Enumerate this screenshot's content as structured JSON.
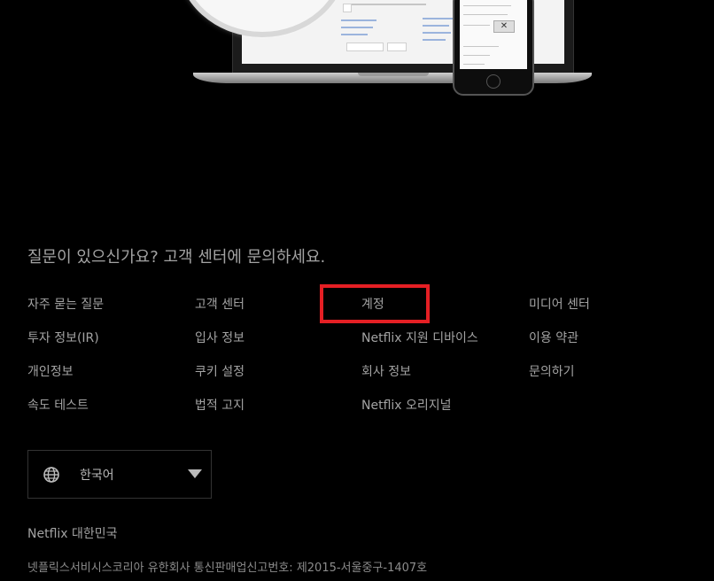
{
  "footer": {
    "questions_text": "질문이 있으신가요? 고객 센터에 문의하세요.",
    "link_columns": [
      [
        "자주 묻는 질문",
        "투자 정보(IR)",
        "개인정보",
        "속도 테스트"
      ],
      [
        "고객 센터",
        "입사 정보",
        "쿠키 설정",
        "법적 고지"
      ],
      [
        "계정",
        "Netflix 지원 디바이스",
        "회사 정보",
        "Netflix 오리지널"
      ],
      [
        "미디어 센터",
        "이용 약관",
        "문의하기"
      ]
    ],
    "highlighted_link": "계정",
    "highlight_color": "#e51f24",
    "language": {
      "selected": "한국어",
      "icon": "globe-icon"
    },
    "country_text": "Netflix 대한민국",
    "legal_text": "넷플릭스서비시스코리아 유한회사 통신판매업신고번호: 제2015-서울중구-1407호"
  }
}
